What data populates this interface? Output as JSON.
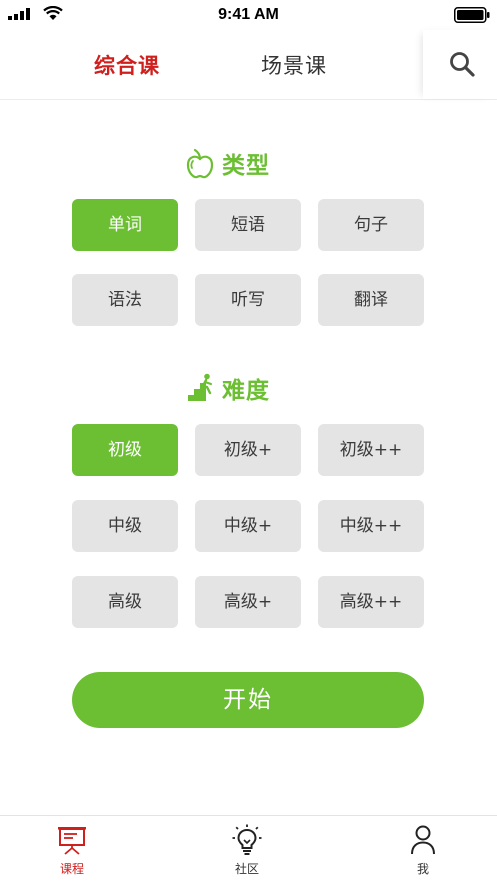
{
  "status_bar": {
    "time": "9:41 AM"
  },
  "top_tabs": {
    "active": "综合课",
    "inactive": "场景课"
  },
  "type_section": {
    "title": "类型",
    "options": [
      "单词",
      "短语",
      "句子",
      "语法",
      "听写",
      "翻译"
    ],
    "selected": "单词"
  },
  "difficulty_section": {
    "title": "难度",
    "options": [
      "初级",
      "初级+",
      "初级++",
      "中级",
      "中级+",
      "中级++",
      "高级",
      "高级+",
      "高级++"
    ],
    "selected": "初级"
  },
  "start_label": "开始",
  "bottom_tabs": {
    "course": "课程",
    "community": "社区",
    "me": "我",
    "active": "课程"
  },
  "colors": {
    "accent_green": "#6cbf33",
    "active_red": "#d0201e",
    "chip_gray": "#e4e4e4"
  },
  "icons": {
    "search": "search-icon",
    "type": "apple-icon",
    "difficulty": "climbing-stairs-icon",
    "course": "presentation-board-icon",
    "community": "lightbulb-icon",
    "me": "person-icon"
  }
}
